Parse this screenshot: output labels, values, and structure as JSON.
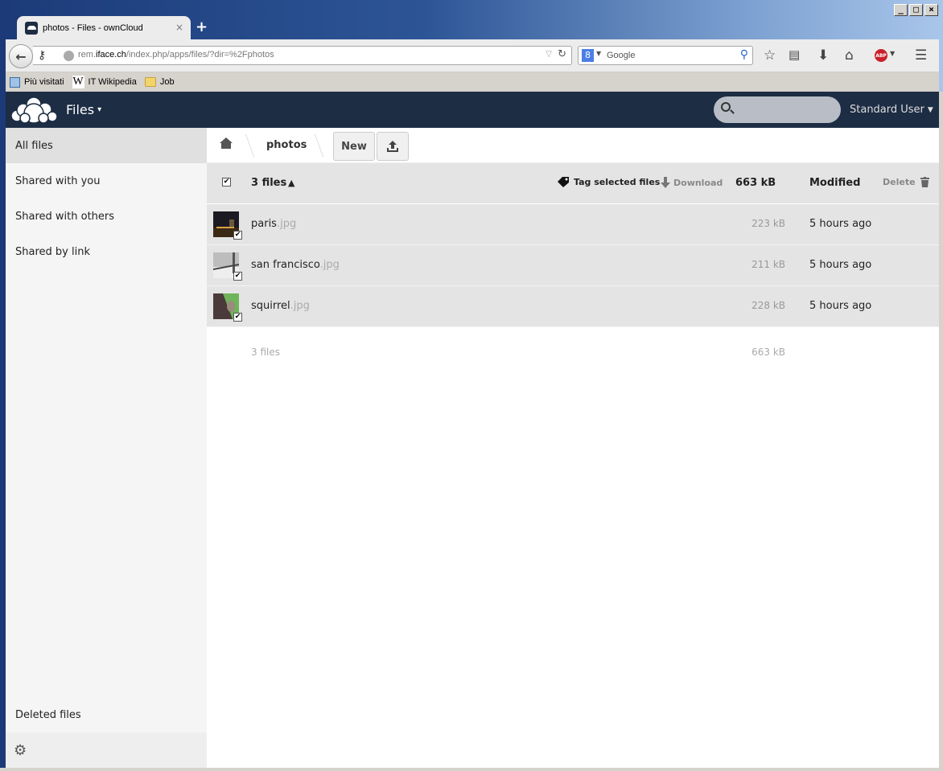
{
  "browser": {
    "tab": {
      "title": "photos - Files - ownCloud",
      "close_glyph": "×"
    },
    "new_tab_glyph": "+",
    "window_controls": {
      "minimize": "_",
      "maximize": "□",
      "close": "×"
    },
    "url": {
      "host_prefix": "rem.",
      "host_domain": "iface.ch",
      "path": "/index.php/apps/files/?dir=%2Fphotos"
    },
    "search": {
      "engine_glyph": "8",
      "placeholder": "Google"
    },
    "bookmarks": [
      {
        "label": "Più visitati",
        "icon": "search-icon"
      },
      {
        "label": "IT Wikipedia",
        "icon": "wikipedia-icon"
      },
      {
        "label": "Job",
        "icon": "folder-icon"
      }
    ],
    "abp_label": "ABP"
  },
  "app": {
    "header": {
      "app_name": "Files",
      "caret": "▾",
      "search_placeholder": "",
      "user_name": "Standard User"
    },
    "sidebar": {
      "items": [
        {
          "label": "All files",
          "active": true
        },
        {
          "label": "Shared with you",
          "active": false
        },
        {
          "label": "Shared with others",
          "active": false
        },
        {
          "label": "Shared by link",
          "active": false
        }
      ],
      "deleted_files": "Deleted files"
    },
    "controls": {
      "breadcrumb": [
        "photos"
      ],
      "new_label": "New"
    },
    "table": {
      "header": {
        "selected_count": "3 files",
        "sort_glyph": "▲",
        "tag_selected": "Tag selected files",
        "download": "Download",
        "total_size": "663 kB",
        "modified": "Modified",
        "delete": "Delete"
      },
      "rows": [
        {
          "base": "paris",
          "ext": ".jpg",
          "size": "223 kB",
          "modified": "5 hours ago",
          "selected": true
        },
        {
          "base": "san francisco",
          "ext": ".jpg",
          "size": "211 kB",
          "modified": "5 hours ago",
          "selected": true
        },
        {
          "base": "squirrel",
          "ext": ".jpg",
          "size": "228 kB",
          "modified": "5 hours ago",
          "selected": true
        }
      ],
      "summary": {
        "count": "3 files",
        "size": "663 kB"
      }
    }
  }
}
